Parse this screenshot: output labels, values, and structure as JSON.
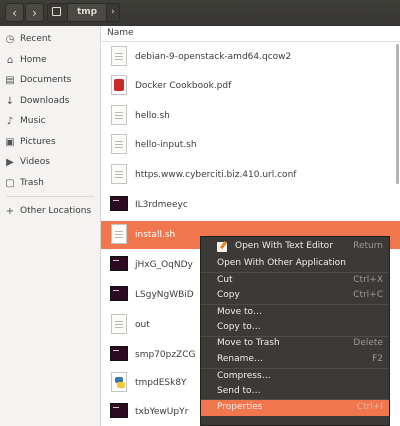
{
  "header": {
    "back_icon": "‹",
    "forward_icon": "›",
    "path_home_icon": "home-icon",
    "path_current": "tmp",
    "path_next_icon": "›"
  },
  "sidebar": {
    "items": [
      {
        "label": "Recent",
        "icon": "◷"
      },
      {
        "label": "Home",
        "icon": "⌂"
      },
      {
        "label": "Documents",
        "icon": "▤"
      },
      {
        "label": "Downloads",
        "icon": "↓"
      },
      {
        "label": "Music",
        "icon": "♪"
      },
      {
        "label": "Pictures",
        "icon": "▣"
      },
      {
        "label": "Videos",
        "icon": "▶"
      },
      {
        "label": "Trash",
        "icon": "▢"
      },
      {
        "label": "Other Locations",
        "icon": "+"
      }
    ]
  },
  "main": {
    "column_name": "Name",
    "files": [
      {
        "name": "debian-9-openstack-amd64.qcow2",
        "icon": "doc"
      },
      {
        "name": "Docker Cookbook.pdf",
        "icon": "pdf"
      },
      {
        "name": "hello.sh",
        "icon": "doc"
      },
      {
        "name": "hello-input.sh",
        "icon": "doc"
      },
      {
        "name": "https.www.cyberciti.biz.410.url.conf",
        "icon": "doc"
      },
      {
        "name": "IL3rdmeeyc",
        "icon": "term"
      },
      {
        "name": "install.sh",
        "icon": "doc",
        "selected": true
      },
      {
        "name": "jHxG_OqNDy",
        "icon": "term"
      },
      {
        "name": "LSgyNgWBiD",
        "icon": "term"
      },
      {
        "name": "out",
        "icon": "doc"
      },
      {
        "name": "smp70pzZCG",
        "icon": "term"
      },
      {
        "name": "tmpdESk8Y",
        "icon": "py"
      },
      {
        "name": "txbYewUpYr",
        "icon": "term"
      }
    ]
  },
  "context_menu": {
    "items": [
      {
        "label": "Open With Text Editor",
        "shortcut": "Return"
      },
      {
        "label": "Open With Other Application",
        "shortcut": ""
      },
      {
        "label": "Cut",
        "shortcut": "Ctrl+X"
      },
      {
        "label": "Copy",
        "shortcut": "Ctrl+C"
      },
      {
        "label": "Move to…",
        "shortcut": ""
      },
      {
        "label": "Copy to…",
        "shortcut": ""
      },
      {
        "label": "Move to Trash",
        "shortcut": "Delete"
      },
      {
        "label": "Rename…",
        "shortcut": "F2"
      },
      {
        "label": "Compress…",
        "shortcut": ""
      },
      {
        "label": "Send to…",
        "shortcut": ""
      },
      {
        "label": "Properties",
        "shortcut": "Ctrl+I"
      }
    ]
  },
  "colors": {
    "accent": "#f0764d",
    "header_bg": "#3c3b37",
    "menu_bg": "#3b3a36"
  }
}
